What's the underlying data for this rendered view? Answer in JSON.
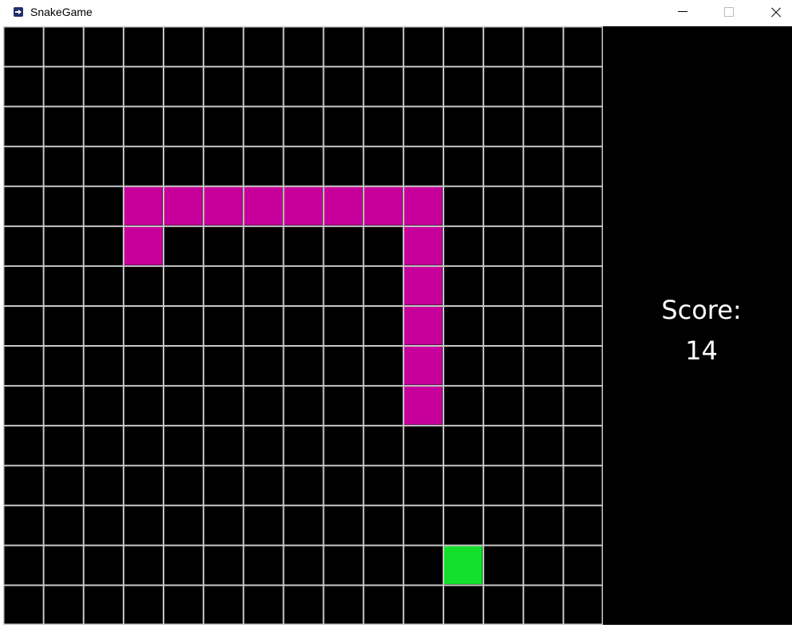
{
  "window": {
    "title": "SnakeGame",
    "icon": "app-arrow-icon"
  },
  "score": {
    "label": "Score:",
    "value": "14"
  },
  "grid": {
    "cols": 15,
    "rows": 15,
    "line_color": "#c8c8c8",
    "background": "#000000"
  },
  "snake": {
    "color": "#c8009b",
    "cells": [
      [
        3,
        5
      ],
      [
        3,
        4
      ],
      [
        4,
        4
      ],
      [
        5,
        4
      ],
      [
        6,
        4
      ],
      [
        7,
        4
      ],
      [
        8,
        4
      ],
      [
        9,
        4
      ],
      [
        10,
        4
      ],
      [
        10,
        5
      ],
      [
        10,
        6
      ],
      [
        10,
        7
      ],
      [
        10,
        8
      ],
      [
        10,
        9
      ]
    ]
  },
  "food": {
    "color": "#13e02c",
    "cell": [
      11,
      13
    ]
  }
}
